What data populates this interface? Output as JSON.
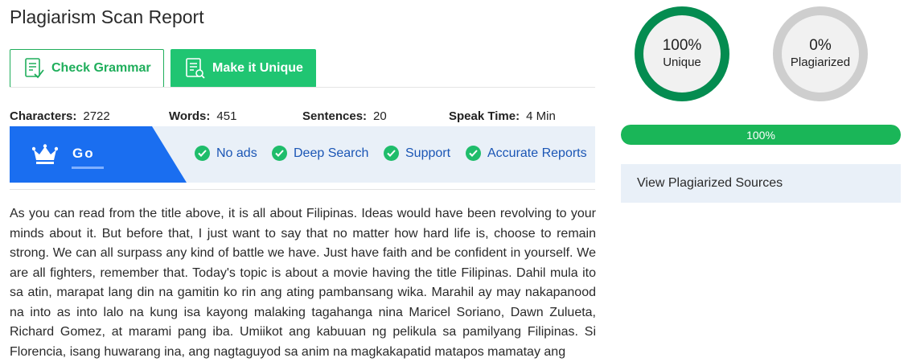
{
  "report": {
    "title": "Plagiarism Scan Report"
  },
  "buttons": {
    "check_grammar": "Check Grammar",
    "make_unique": "Make it Unique"
  },
  "stats": [
    {
      "label": "Characters:",
      "value": "2722"
    },
    {
      "label": "Words:",
      "value": "451"
    },
    {
      "label": "Sentences:",
      "value": "20"
    },
    {
      "label": "Speak Time:",
      "value": "4 Min"
    }
  ],
  "banner": {
    "go_text": "Go",
    "features": [
      "No ads",
      "Deep Search",
      "Support",
      "Accurate Reports"
    ]
  },
  "content": {
    "text": "As you can read from the title above, it is all about Filipinas. Ideas would have been revolving to your minds about it. But before that, I just want to say that no matter how hard life is, choose to remain strong. We can all surpass any kind of battle we have. Just have faith and be confident in yourself. We are all fighters, remember that. Today's topic is about a movie having the title Filipinas. Dahil mula ito sa atin, marapat lang din na gamitin ko rin ang ating pambansang wika. Marahil ay may nakapanood na into as into lalo na kung isa kayong malaking tagahanga nina Maricel Soriano, Dawn Zulueta, Richard Gomez, at marami pang iba. Umiikot ang kabuuan ng pelikula sa pamilyang Filipinas. Si Florencia, isang huwarang ina, ang nagtaguyod sa anim na magkakapatid matapos mamatay ang"
  },
  "results": {
    "unique": {
      "percent": "100%",
      "label": "Unique"
    },
    "plagiarized": {
      "percent": "0%",
      "label": "Plagiarized"
    },
    "progress": {
      "value": 100,
      "label": "100%"
    },
    "sources_label": "View Plagiarized Sources"
  },
  "colors": {
    "accent_green": "#20c572",
    "unique_ring": "#048c50",
    "plagiarized_ring": "#cecece",
    "banner_blue": "#1a6ef0",
    "feature_text": "#1b56b5"
  },
  "icons": {
    "check_grammar": "document-check-icon",
    "make_unique": "document-search-icon",
    "premium": "crown-icon",
    "feature": "check-circle-icon"
  }
}
